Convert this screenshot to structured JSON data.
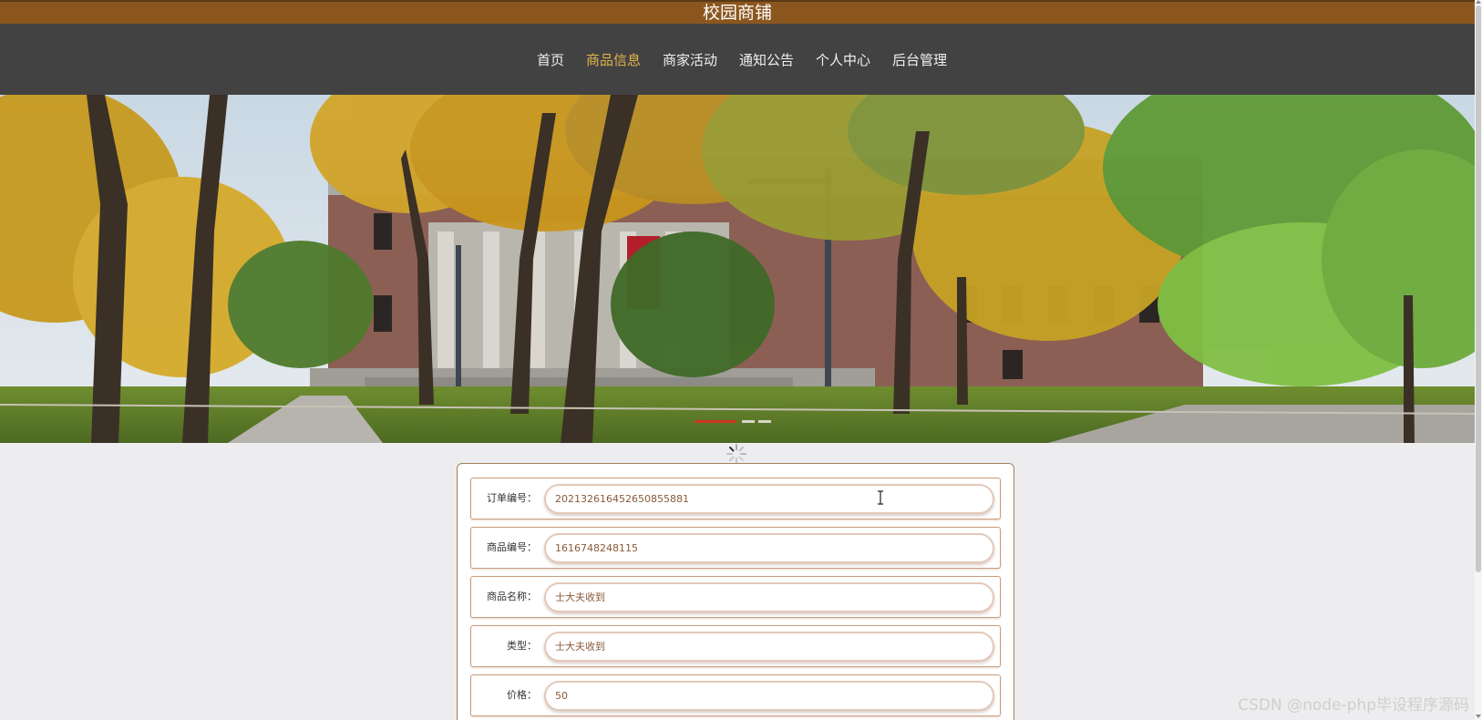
{
  "header": {
    "title": "校园商铺"
  },
  "nav": {
    "items": [
      {
        "label": "首页",
        "active": false
      },
      {
        "label": "商品信息",
        "active": true
      },
      {
        "label": "商家活动",
        "active": false
      },
      {
        "label": "通知公告",
        "active": false
      },
      {
        "label": "个人中心",
        "active": false
      },
      {
        "label": "后台管理",
        "active": false
      }
    ]
  },
  "form": {
    "order_no": {
      "label": "订单编号：",
      "value": "202132616452650855881"
    },
    "product_no": {
      "label": "商品编号：",
      "value": "1616748248115"
    },
    "product_name": {
      "label": "商品名称：",
      "value": "士大夫收到"
    },
    "type": {
      "label": "类型：",
      "value": "士大夫收到"
    },
    "price": {
      "label": "价格：",
      "value": "50"
    }
  },
  "watermark": "CSDN @node-php毕设程序源码",
  "colors": {
    "topbar": "#8b561e",
    "navbar": "#434243",
    "nav_active": "#e0b349",
    "field_border": "#e3c8ba"
  }
}
